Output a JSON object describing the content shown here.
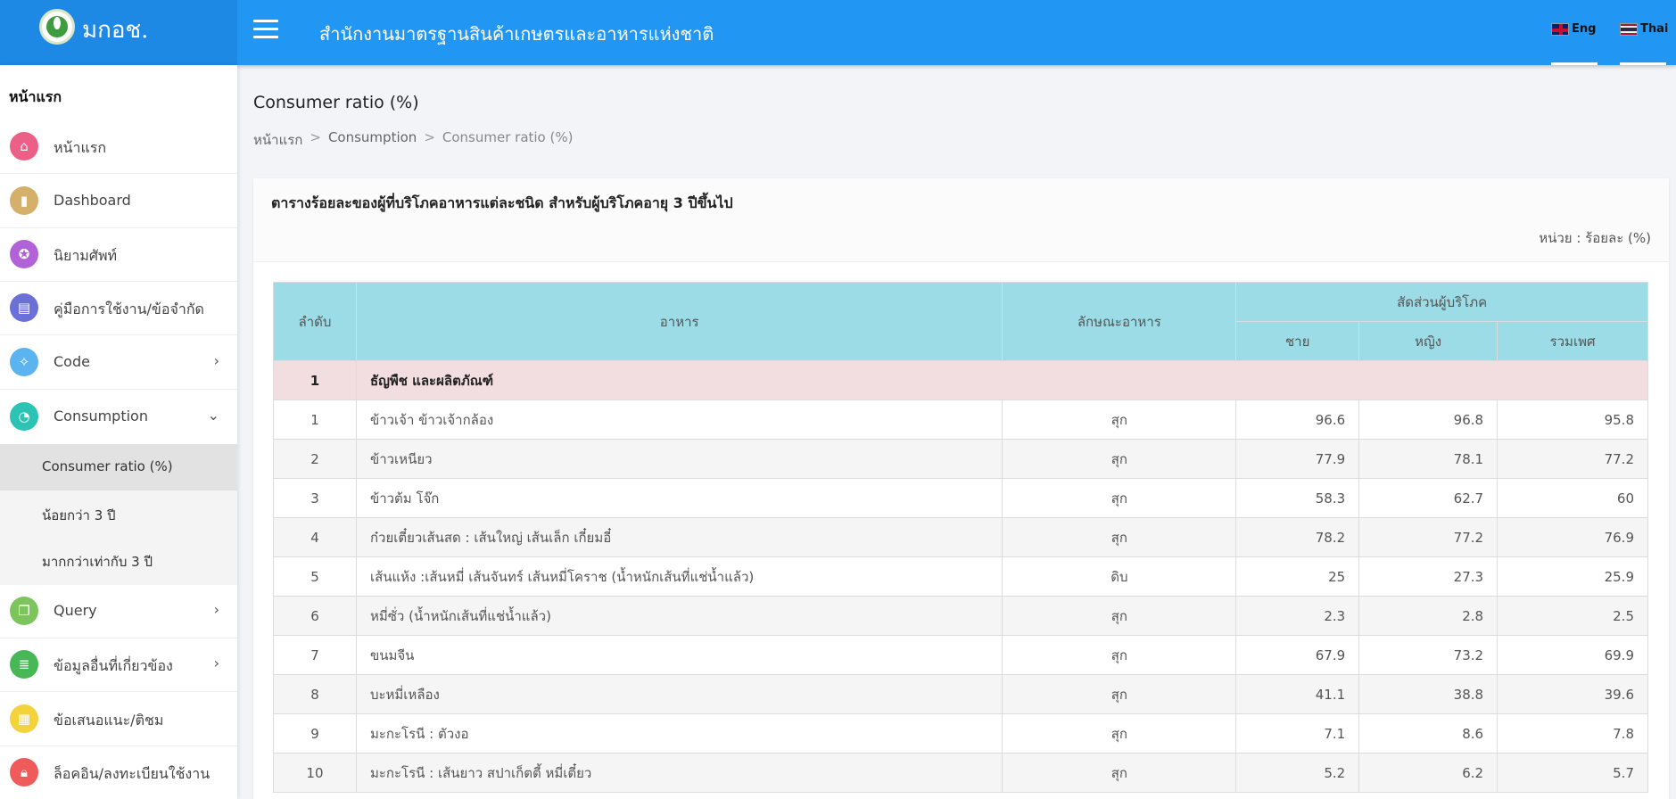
{
  "header": {
    "brand": "มกอช.",
    "title": "สำนักงานมาตรฐานสินค้าเกษตรและอาหารแห่งชาติ",
    "lang_eng": "Eng",
    "lang_thai": "Thai"
  },
  "sidebar": {
    "heading": "หน้าแรก",
    "items": [
      {
        "label": "หน้าแรก",
        "icon": "home-icon",
        "color": "#ec6088"
      },
      {
        "label": "Dashboard",
        "icon": "bar-chart-icon",
        "color": "#d4b06a"
      },
      {
        "label": "นิยามศัพท์",
        "icon": "badge-icon",
        "color": "#b062d6"
      },
      {
        "label": "คู่มือการใช้งาน/ข้อจำกัด",
        "icon": "book-icon",
        "color": "#6b6fd8"
      },
      {
        "label": "Code",
        "icon": "wand-icon",
        "color": "#5bb4f0"
      },
      {
        "label": "Consumption",
        "icon": "pie-chart-icon",
        "color": "#2bc4b4"
      },
      {
        "label": "Query",
        "icon": "document-icon",
        "color": "#7cc45c"
      },
      {
        "label": "ข้อมูลอื่นที่เกี่ยวข้อง",
        "icon": "database-icon",
        "color": "#47b855"
      },
      {
        "label": "ข้อเสนอแนะ/ติชม",
        "icon": "note-icon",
        "color": "#f3d23b"
      },
      {
        "label": "ล็อคอิน/ลงทะเบียนใช้งาน",
        "icon": "lock-icon",
        "color": "#ef5a5a"
      }
    ],
    "sub_items": [
      {
        "label": "Consumer ratio (%)"
      },
      {
        "label": "น้อยกว่า 3 ปี"
      },
      {
        "label": "มากกว่าเท่ากับ 3 ปี"
      }
    ]
  },
  "page": {
    "title": "Consumer ratio (%)",
    "breadcrumb": [
      "หน้าแรก",
      "Consumption",
      "Consumer ratio (%)"
    ],
    "breadcrumb_sep": ">"
  },
  "card": {
    "title": "ตารางร้อยละของผู้ที่บริโภคอาหารแต่ละชนิด  สำหรับผู้บริโภคอายุ 3 ปีขึ้นไป",
    "unit": "หน่วย : ร้อยละ (%)"
  },
  "table": {
    "headers": {
      "order": "ลำดับ",
      "food": "อาหาร",
      "type": "ลักษณะอาหาร",
      "ratio": "สัดส่วนผู้บริโภค",
      "male": "ชาย",
      "female": "หญิง",
      "total": "รวมเพศ"
    },
    "group": {
      "num": "1",
      "name": "ธัญพืช  และผลิตภัณฑ์"
    },
    "rows": [
      {
        "num": "1",
        "food": "ข้าวเจ้า ข้าวเจ้ากล้อง",
        "type": "สุก",
        "male": "96.6",
        "female": "96.8",
        "total": "95.8"
      },
      {
        "num": "2",
        "food": "ข้าวเหนียว",
        "type": "สุก",
        "male": "77.9",
        "female": "78.1",
        "total": "77.2"
      },
      {
        "num": "3",
        "food": "ข้าวต้ม โจ๊ก",
        "type": "สุก",
        "male": "58.3",
        "female": "62.7",
        "total": "60"
      },
      {
        "num": "4",
        "food": "ก๋วยเตี๋ยวเส้นสด : เส้นใหญ่ เส้นเล็ก เกี๋ยมอี๋",
        "type": "สุก",
        "male": "78.2",
        "female": "77.2",
        "total": "76.9"
      },
      {
        "num": "5",
        "food": "เส้นแห้ง :เส้นหมี่   เส้นจันทร์  เส้นหมี่โคราช  (น้ำหนักเส้นที่แช่น้ำแล้ว)",
        "type": "ดิบ",
        "male": "25",
        "female": "27.3",
        "total": "25.9"
      },
      {
        "num": "6",
        "food": "หมี่ซั่ว   (น้ำหนักเส้นที่แช่น้ำแล้ว)",
        "type": "สุก",
        "male": "2.3",
        "female": "2.8",
        "total": "2.5"
      },
      {
        "num": "7",
        "food": "ขนมจีน",
        "type": "สุก",
        "male": "67.9",
        "female": "73.2",
        "total": "69.9"
      },
      {
        "num": "8",
        "food": "บะหมี่เหลือง",
        "type": "สุก",
        "male": "41.1",
        "female": "38.8",
        "total": "39.6"
      },
      {
        "num": "9",
        "food": "มะกะโรนี : ตัวงอ",
        "type": "สุก",
        "male": "7.1",
        "female": "8.6",
        "total": "7.8"
      },
      {
        "num": "10",
        "food": "มะกะโรนี : เส้นยาว  สปาเก็ตตี้  หมี่เตี๋ยว",
        "type": "สุก",
        "male": "5.2",
        "female": "6.2",
        "total": "5.7"
      }
    ]
  }
}
